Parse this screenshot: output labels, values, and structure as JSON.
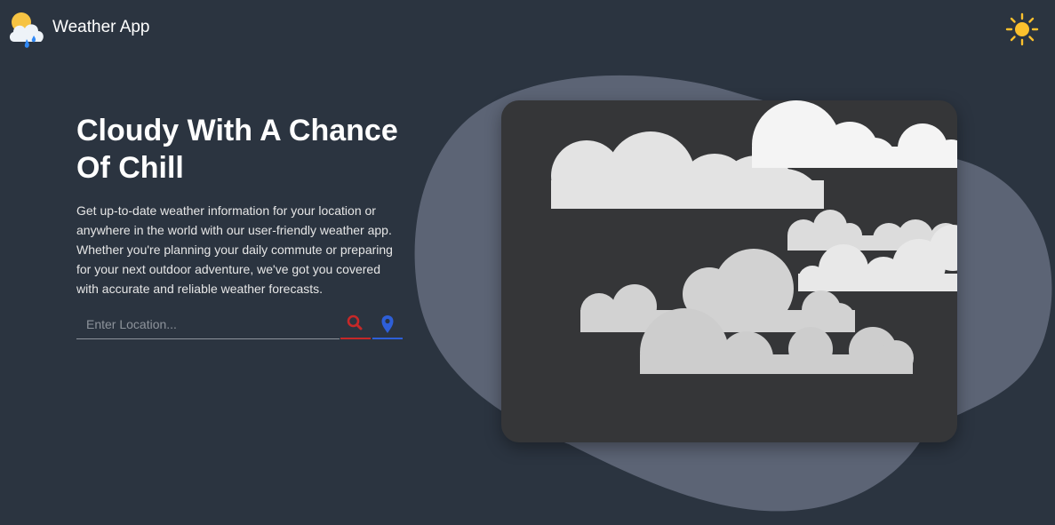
{
  "header": {
    "app_title": "Weather App",
    "logo_icon": "cloud-sun-rain-icon",
    "theme_toggle_icon": "sun-icon"
  },
  "hero": {
    "title": "Cloudy With A Chance Of Chill",
    "description": "Get up-to-date weather information for your location or anywhere in the world with our user-friendly weather app. Whether you're planning your daily commute or preparing for your next outdoor adventure, we've got you covered with accurate and reliable weather forecasts."
  },
  "search": {
    "placeholder": "Enter Location...",
    "search_icon": "search-icon",
    "locate_icon": "location-pin-icon"
  },
  "colors": {
    "background": "#2b3440",
    "blob": "#5c6475",
    "card": "#353638",
    "search_accent": "#c62828",
    "locate_accent": "#2e5fd8",
    "sun": "#fbc02d"
  }
}
